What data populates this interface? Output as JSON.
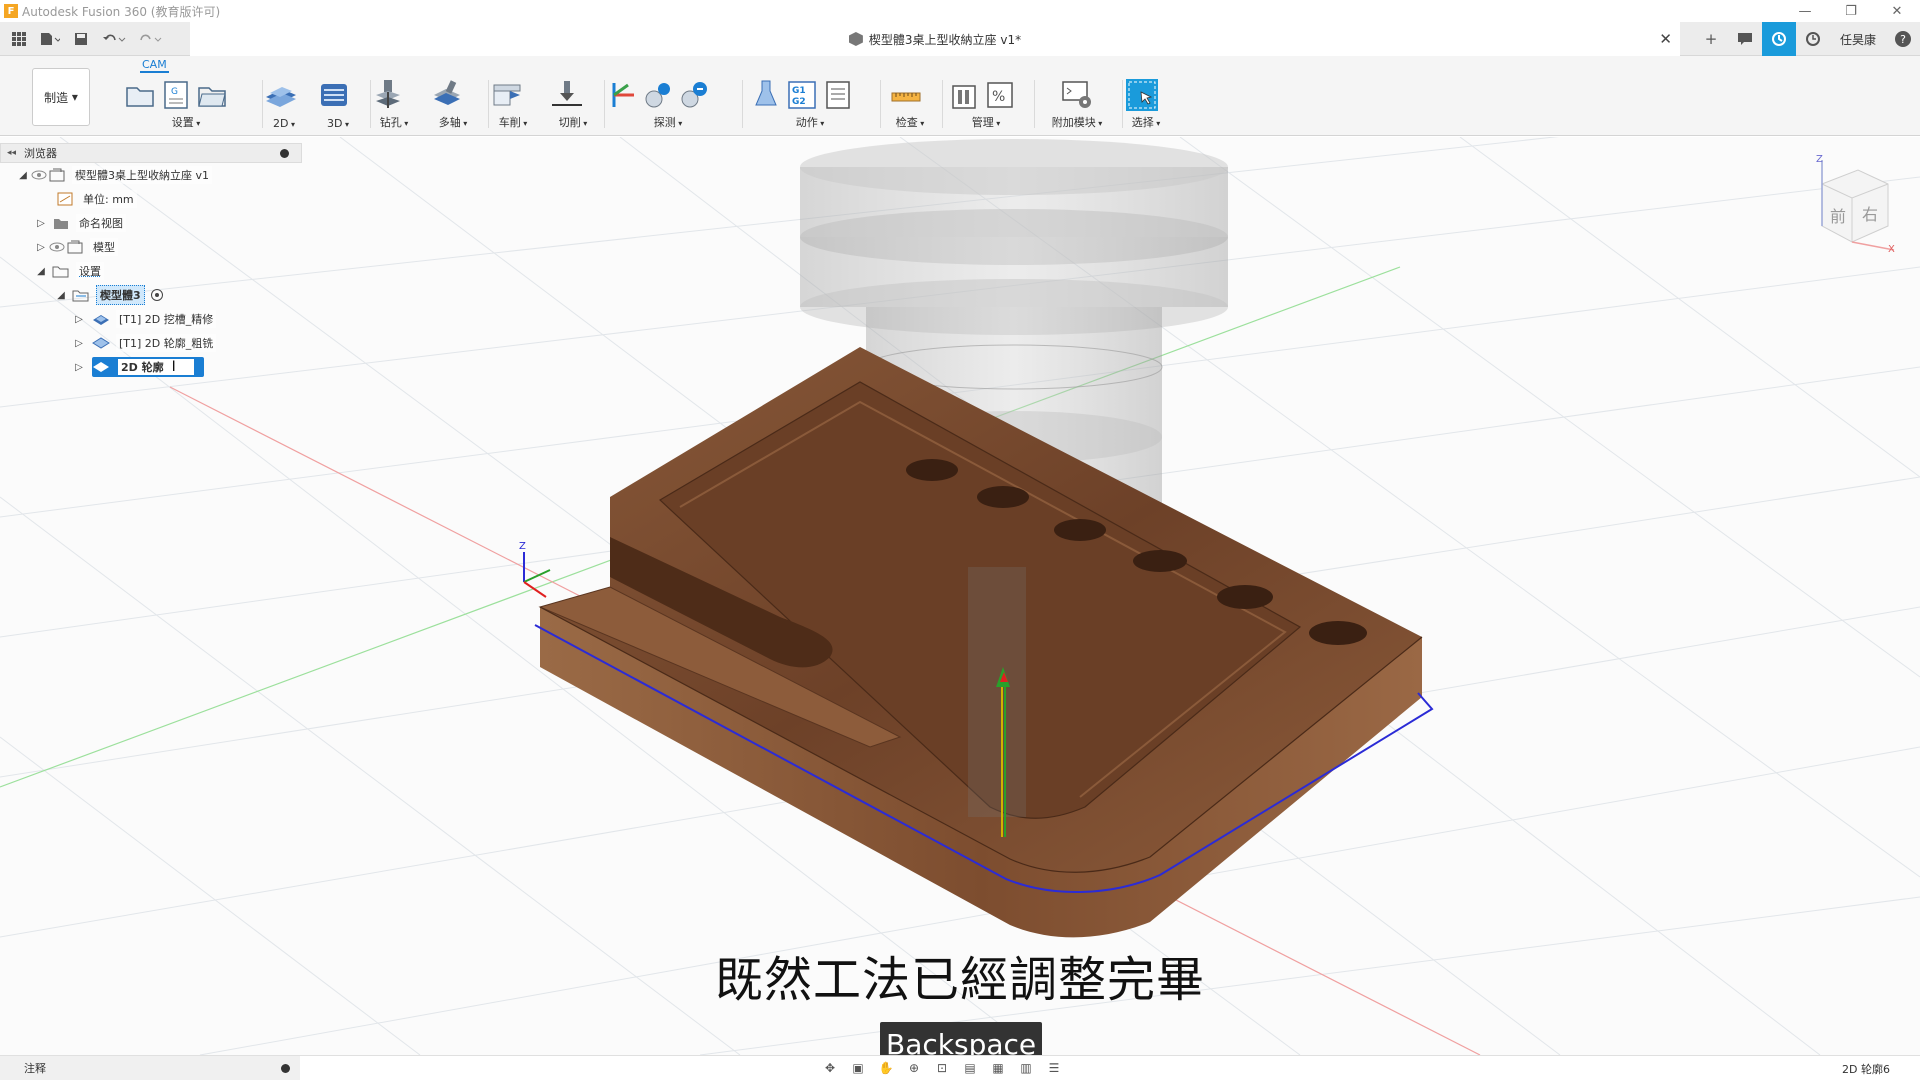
{
  "window": {
    "app_title": "Autodesk Fusion 360 (教育版许可)",
    "logo_letter": "F",
    "minimize": "—",
    "restore": "❐",
    "close": "✕"
  },
  "doc_tab": {
    "title": "楔型體3桌上型收納立座 v1*",
    "close": "✕"
  },
  "right_tools": {
    "new_tab": "+",
    "user_name": "任昊康",
    "help": "?"
  },
  "ribbon": {
    "active_tab": "CAM",
    "workspace": "制造",
    "groups": [
      {
        "label": "设置"
      },
      {
        "label": "2D"
      },
      {
        "label": "3D"
      },
      {
        "label": "钻孔"
      },
      {
        "label": "多轴"
      },
      {
        "label": "车削"
      },
      {
        "label": "切削"
      },
      {
        "label": "探测"
      },
      {
        "label": "动作"
      },
      {
        "label": "检查"
      },
      {
        "label": "管理"
      },
      {
        "label": "附加模块"
      },
      {
        "label": "选择"
      }
    ]
  },
  "browser": {
    "header": "浏览器",
    "nodes": [
      {
        "label": "楔型體3桌上型收納立座 v1"
      },
      {
        "label": "单位: mm"
      },
      {
        "label": "命名视图"
      },
      {
        "label": "模型"
      },
      {
        "label": "设置"
      },
      {
        "label": "楔型體3"
      },
      {
        "label": "[T1] 2D 挖槽_精修"
      },
      {
        "label": "[T1] 2D 轮廓_粗铣"
      },
      {
        "label": "2D 轮廓"
      }
    ]
  },
  "viewcube": {
    "front": "前",
    "right": "右",
    "z": "Z",
    "x": "X"
  },
  "axis": {
    "z": "Z"
  },
  "subtitle": "既然工法已經調整完畢",
  "keycast": "Backspace",
  "bottom": {
    "comments": "注释",
    "status": "2D 轮廓6"
  },
  "colors": {
    "accent": "#1a7ed3",
    "wood": "#7a4a2e",
    "toolpath": "#2b2bd6"
  }
}
